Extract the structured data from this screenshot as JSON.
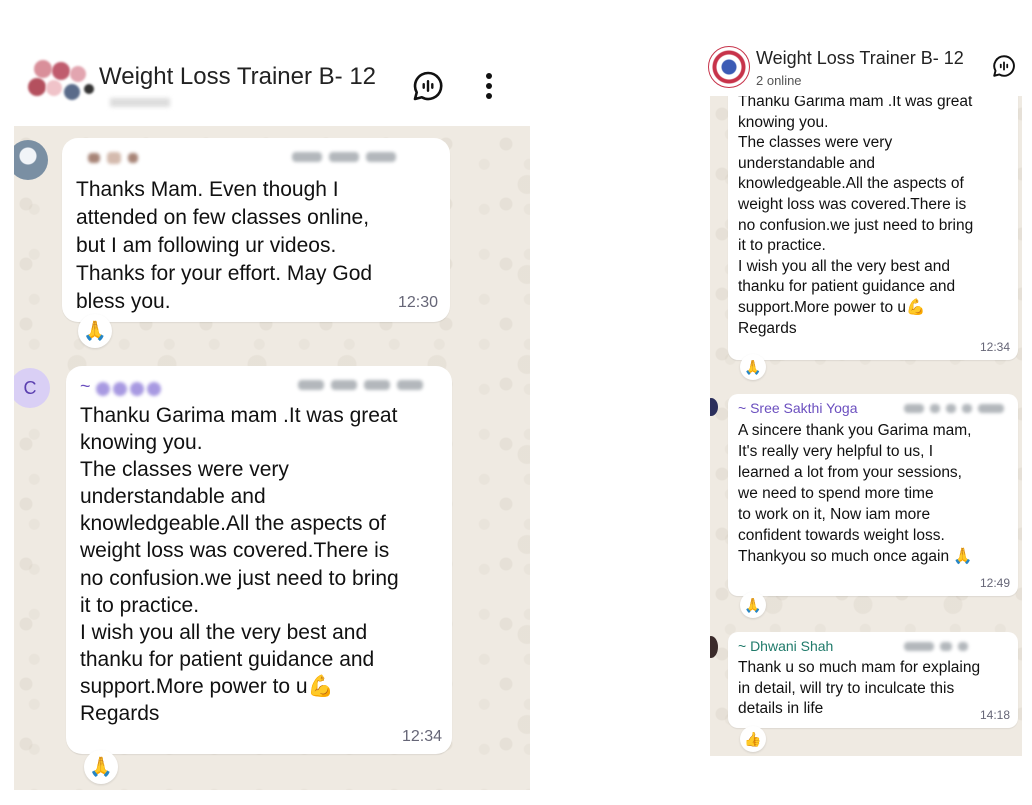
{
  "left": {
    "header": {
      "title": "Weight Loss Trainer B- 12"
    },
    "avatar_initial": "C",
    "messages": [
      {
        "text": "Thanks Mam. Even though I\nattended on few classes online,\nbut I am following ur videos.\nThanks for your effort. May God\nbless you.",
        "time": "12:30",
        "reaction": "🙏"
      },
      {
        "sender_prefix": "~",
        "text": "Thanku Garima mam .It was great\nknowing you.\nThe classes were very\nunderstandable and\nknowledgeable.All the aspects of\nweight loss was covered.There is\nno confusion.we just need to bring\nit to practice.\nI wish you all the very best and\nthanku for patient guidance and\nsupport.More power to u💪\nRegards",
        "time": "12:34",
        "reaction": "🙏"
      }
    ]
  },
  "right": {
    "header": {
      "title": "Weight Loss Trainer B- 12",
      "subtitle": "2 online"
    },
    "messages": [
      {
        "text": "Thanku Garima mam .It was great\nknowing you.\nThe classes were very\nunderstandable and\nknowledgeable.All the aspects of\nweight loss was covered.There is\nno confusion.we just need to bring\nit to practice.\nI wish you all the very best and\nthanku for patient guidance and\nsupport.More power to u💪\nRegards",
        "time": "12:34",
        "reaction": "🙏"
      },
      {
        "sender": "~ Sree Sakthi Yoga",
        "text": "A sincere thank you Garima mam,\nIt's really very helpful to us, I\nlearned a lot from your sessions,\nwe need to spend more time\nto work on it, Now iam more\nconfident towards weight loss.\nThankyou so much once again 🙏",
        "time": "12:49",
        "reaction": "🙏"
      },
      {
        "sender": "~ Dhwani Shah",
        "text": "Thank u so much mam for explaing\nin detail, will try to inculcate this\ndetails in life",
        "time": "14:18",
        "reaction": "👍"
      }
    ]
  },
  "colors": {
    "chat_bg": "#efeae2",
    "bubble": "#ffffff",
    "sender_purple": "#6b4fbf",
    "sender_teal": "#1f7a6a",
    "avatar_c": "#d9cff5"
  },
  "icons": [
    "voice-chat-icon",
    "more-vertical-icon",
    "group-avatar-icon"
  ]
}
